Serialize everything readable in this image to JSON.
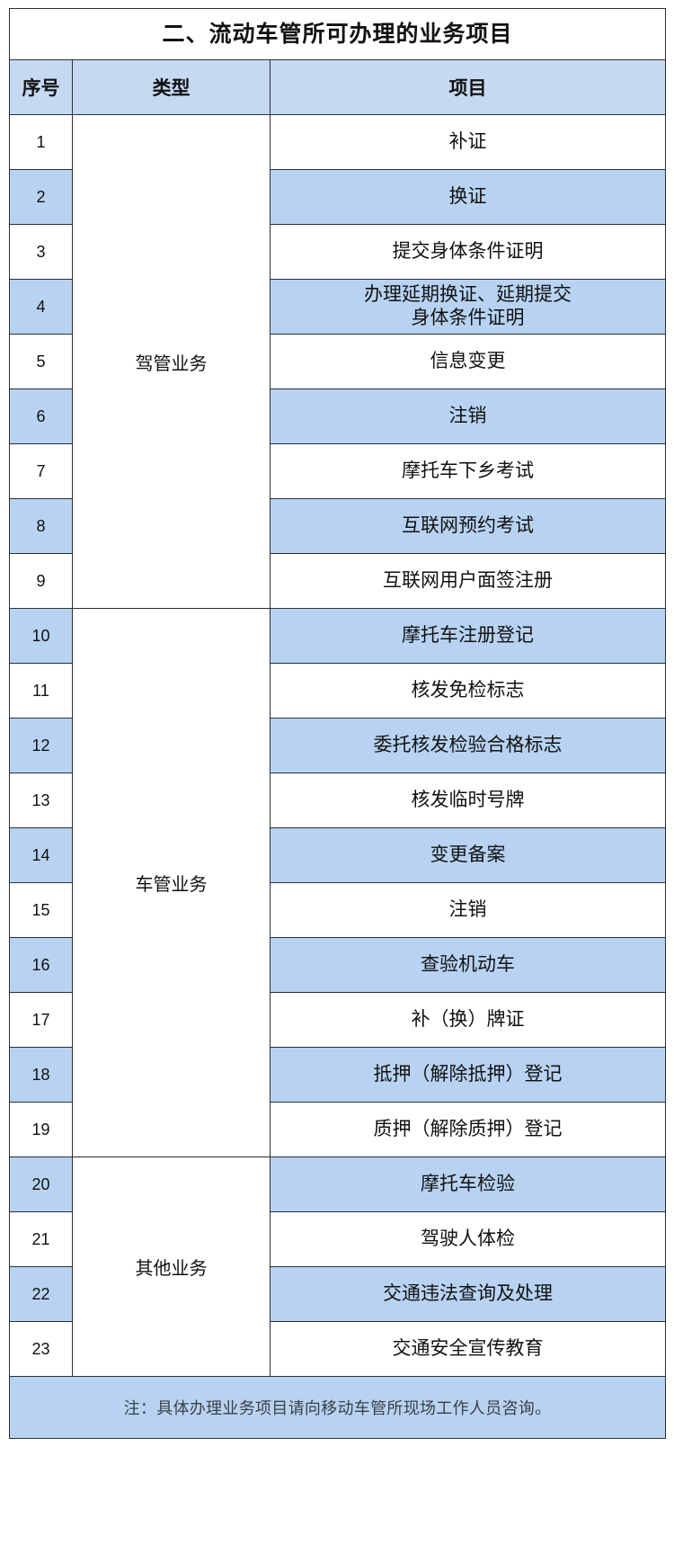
{
  "document": {
    "title": "二、流动车管所可办理的业务项目"
  },
  "table": {
    "columns": {
      "no": "序号",
      "type": "类型",
      "item": "项目"
    },
    "groups": [
      {
        "label": "驾管业务",
        "span": 9
      },
      {
        "label": "车管业务",
        "span": 10
      },
      {
        "label": "其他业务",
        "span": 4
      }
    ],
    "rows": [
      {
        "no": "1",
        "item": "补证",
        "item2": "",
        "fill": "white"
      },
      {
        "no": "2",
        "item": "换证",
        "item2": "",
        "fill": "blue"
      },
      {
        "no": "3",
        "item": "提交身体条件证明",
        "item2": "",
        "fill": "white"
      },
      {
        "no": "4",
        "item": "办理延期换证、延期提交",
        "item2": "身体条件证明",
        "fill": "blue"
      },
      {
        "no": "5",
        "item": "信息变更",
        "item2": "",
        "fill": "white"
      },
      {
        "no": "6",
        "item": "注销",
        "item2": "",
        "fill": "blue"
      },
      {
        "no": "7",
        "item": "摩托车下乡考试",
        "item2": "",
        "fill": "white"
      },
      {
        "no": "8",
        "item": "互联网预约考试",
        "item2": "",
        "fill": "blue"
      },
      {
        "no": "9",
        "item": "互联网用户面签注册",
        "item2": "",
        "fill": "white"
      },
      {
        "no": "10",
        "item": "摩托车注册登记",
        "item2": "",
        "fill": "blue"
      },
      {
        "no": "11",
        "item": "核发免检标志",
        "item2": "",
        "fill": "white"
      },
      {
        "no": "12",
        "item": "委托核发检验合格标志",
        "item2": "",
        "fill": "blue"
      },
      {
        "no": "13",
        "item": "核发临时号牌",
        "item2": "",
        "fill": "white"
      },
      {
        "no": "14",
        "item": "变更备案",
        "item2": "",
        "fill": "blue"
      },
      {
        "no": "15",
        "item": "注销",
        "item2": "",
        "fill": "white"
      },
      {
        "no": "16",
        "item": "查验机动车",
        "item2": "",
        "fill": "blue"
      },
      {
        "no": "17",
        "item": "补（换）牌证",
        "item2": "",
        "fill": "white"
      },
      {
        "no": "18",
        "item": "抵押（解除抵押）登记",
        "item2": "",
        "fill": "blue"
      },
      {
        "no": "19",
        "item": "质押（解除质押）登记",
        "item2": "",
        "fill": "white"
      },
      {
        "no": "20",
        "item": "摩托车检验",
        "item2": "",
        "fill": "blue"
      },
      {
        "no": "21",
        "item": "驾驶人体检",
        "item2": "",
        "fill": "white"
      },
      {
        "no": "22",
        "item": "交通违法查询及处理",
        "item2": "",
        "fill": "blue"
      },
      {
        "no": "23",
        "item": "交通安全宣传教育",
        "item2": "",
        "fill": "white"
      }
    ],
    "note": "注：具体办理业务项目请向移动车管所现场工作人员咨询。"
  },
  "colors": {
    "fill_blue": "#b8d3f2",
    "header_blue": "#c5d9f3",
    "border": "#2b2f38",
    "text": "#111111",
    "note_text": "#3b3f46"
  }
}
